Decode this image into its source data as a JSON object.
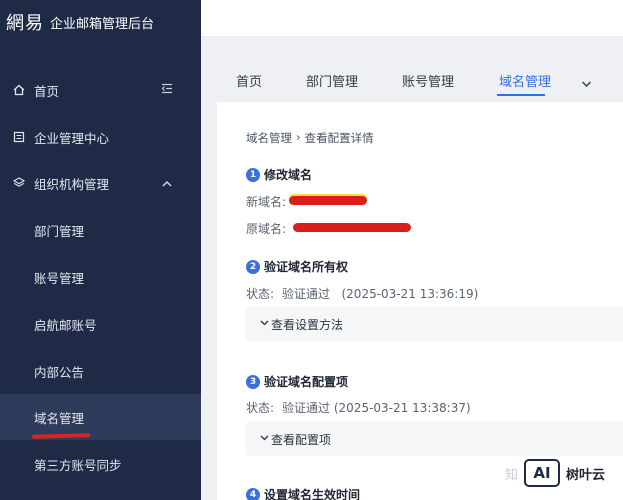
{
  "sidebar": {
    "brand_logo": "網易",
    "brand_title": "企业邮箱管理后台",
    "items": [
      {
        "label": "首页",
        "icon": "home-icon",
        "tail": "collapse-sidebar-icon"
      },
      {
        "label": "企业管理中心",
        "icon": "enterprise-icon"
      },
      {
        "label": "组织机构管理",
        "icon": "layers-icon",
        "tail": "chevron-up-icon"
      },
      {
        "label": "部门管理"
      },
      {
        "label": "账号管理"
      },
      {
        "label": "启航邮账号"
      },
      {
        "label": "内部公告"
      },
      {
        "label": "域名管理",
        "active": true
      },
      {
        "label": "第三方账号同步"
      }
    ],
    "active_color": "#2f3b5a",
    "background": "#1f2a47"
  },
  "tabs": [
    {
      "label": "首页"
    },
    {
      "label": "部门管理"
    },
    {
      "label": "账号管理"
    },
    {
      "label": "域名管理",
      "active": true
    }
  ],
  "tab_more_icon": "chevron-down-icon",
  "accent": "#2f6fe4",
  "breadcrumb": {
    "parent": "域名管理",
    "separator": "›",
    "current": "查看配置详情"
  },
  "sections": [
    {
      "num": "1",
      "title": "修改域名",
      "fields": [
        {
          "label": "新域名:"
        },
        {
          "label": "原域名:"
        }
      ]
    },
    {
      "num": "2",
      "title": "验证域名所有权",
      "status_label": "状态:",
      "status_value": "验证通过   (2025-03-21 13:36:19)",
      "collapse_label": "查看设置方法"
    },
    {
      "num": "3",
      "title": "验证域名配置项",
      "status_label": "状态:",
      "status_value": "验证通过 (2025-03-21 13:38:37)",
      "collapse_label": "查看配置项"
    },
    {
      "num": "4",
      "title": "设置域名生效时间"
    }
  ],
  "watermark": {
    "prefix": "知",
    "logo": "AI",
    "name": "树叶云"
  }
}
